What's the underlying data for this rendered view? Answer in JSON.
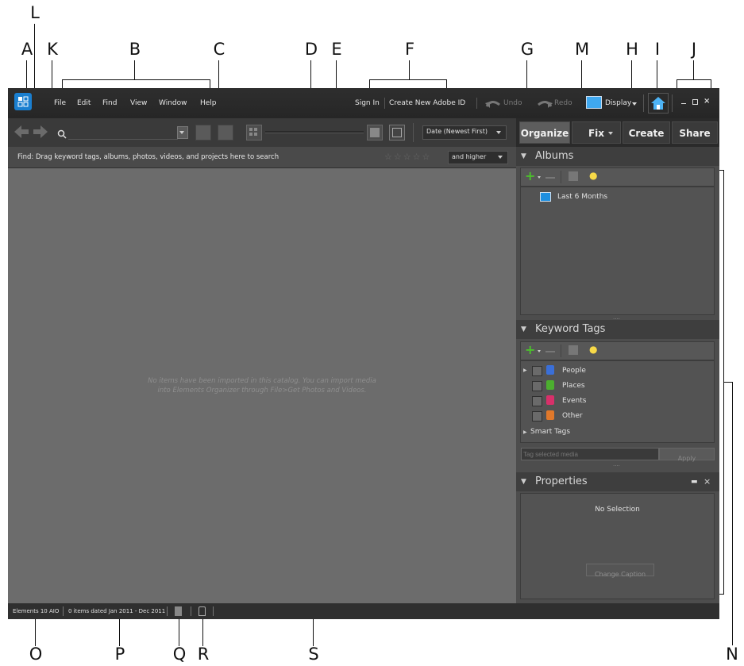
{
  "callouts": {
    "A": "A",
    "B": "B",
    "C": "C",
    "D": "D",
    "E": "E",
    "F": "F",
    "G": "G",
    "H": "H",
    "I": "I",
    "J": "J",
    "K": "K",
    "L": "L",
    "M": "M",
    "N": "N",
    "O": "O",
    "P": "P",
    "Q": "Q",
    "R": "R",
    "S": "S"
  },
  "menubar": {
    "items": [
      "File",
      "Edit",
      "Find",
      "View",
      "Window",
      "Help"
    ],
    "sign_in": "Sign In",
    "create_id": "Create New Adobe ID",
    "undo": "Undo",
    "redo": "Redo",
    "display": "Display"
  },
  "toolbar": {
    "search_placeholder": "",
    "sort": "Date (Newest First)"
  },
  "tabs": [
    "Organize",
    "Fix",
    "Create",
    "Share"
  ],
  "findbar": {
    "text": "Find: Drag keyword tags, albums, photos, videos, and projects here to search",
    "rating_filter": "and higher"
  },
  "content": {
    "empty_message_line1": "No items have been imported in this catalog. You can import media",
    "empty_message_line2": "into Elements Organizer through File>Get Photos and Videos."
  },
  "albums": {
    "title": "Albums",
    "items": [
      "Last 6 Months"
    ]
  },
  "keyword_tags": {
    "title": "Keyword Tags",
    "items": [
      "People",
      "Places",
      "Events",
      "Other"
    ],
    "smart_tags": "Smart Tags",
    "input_placeholder": "Tag selected media",
    "apply": "Apply"
  },
  "properties": {
    "title": "Properties",
    "no_selection": "No Selection",
    "change_caption": "Change Caption"
  },
  "status": {
    "version": "Elements 10 AIO",
    "items_dated": "0 items dated Jan 2011 - Dec 2011"
  },
  "colors": {
    "accent_blue": "#1a7fd0",
    "people": "#3a6fd8",
    "places": "#4caf2f",
    "events": "#d8306a",
    "other": "#e0782a"
  }
}
